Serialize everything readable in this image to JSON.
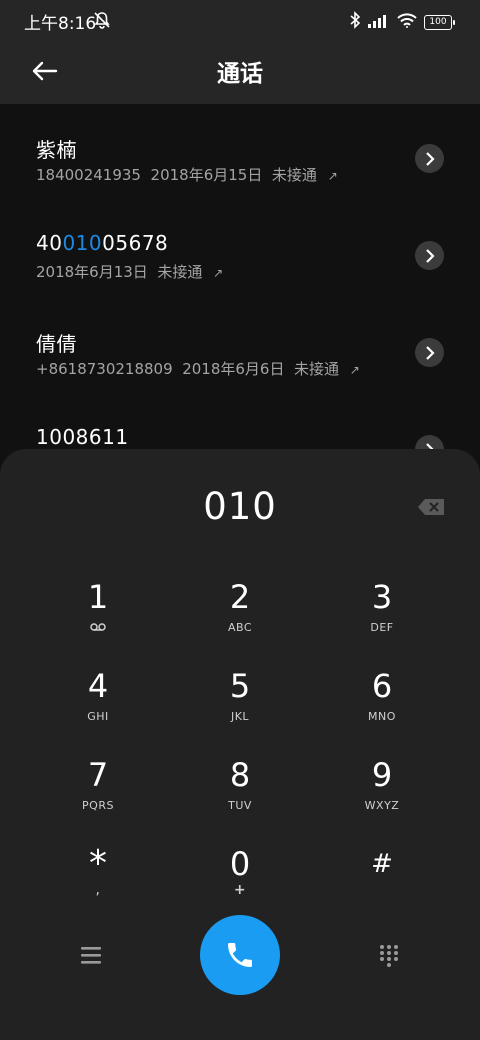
{
  "status": {
    "time": "上午8:16",
    "battery": "100"
  },
  "header": {
    "title": "通话",
    "back_icon": "arrow-left-icon"
  },
  "calls": [
    {
      "name": "紫楠",
      "number": "18400241935",
      "date": "2018年6月15日",
      "status": "未接通",
      "arrow": "↗"
    },
    {
      "name_pre": "40",
      "name_hl": "010",
      "name_post": "05678",
      "number": "",
      "date": "2018年6月13日",
      "status": "未接通",
      "arrow": "↗"
    },
    {
      "name": "倩倩",
      "number": "+8618730218809",
      "date": "2018年6月6日",
      "status": "未接通",
      "arrow": "↗"
    },
    {
      "name": "1008611"
    }
  ],
  "dialer": {
    "number": "010",
    "keys": [
      {
        "digit": "1",
        "letters": ""
      },
      {
        "digit": "2",
        "letters": "ABC"
      },
      {
        "digit": "3",
        "letters": "DEF"
      },
      {
        "digit": "4",
        "letters": "GHI"
      },
      {
        "digit": "5",
        "letters": "JKL"
      },
      {
        "digit": "6",
        "letters": "MNO"
      },
      {
        "digit": "7",
        "letters": "PQRS"
      },
      {
        "digit": "8",
        "letters": "TUV"
      },
      {
        "digit": "9",
        "letters": "WXYZ"
      },
      {
        "digit": "*",
        "letters": ","
      },
      {
        "digit": "0",
        "letters": "+"
      },
      {
        "digit": "#",
        "letters": ""
      }
    ]
  },
  "colors": {
    "accent": "#1a9cf2",
    "highlight": "#1e88e5",
    "panel": "#222222"
  }
}
